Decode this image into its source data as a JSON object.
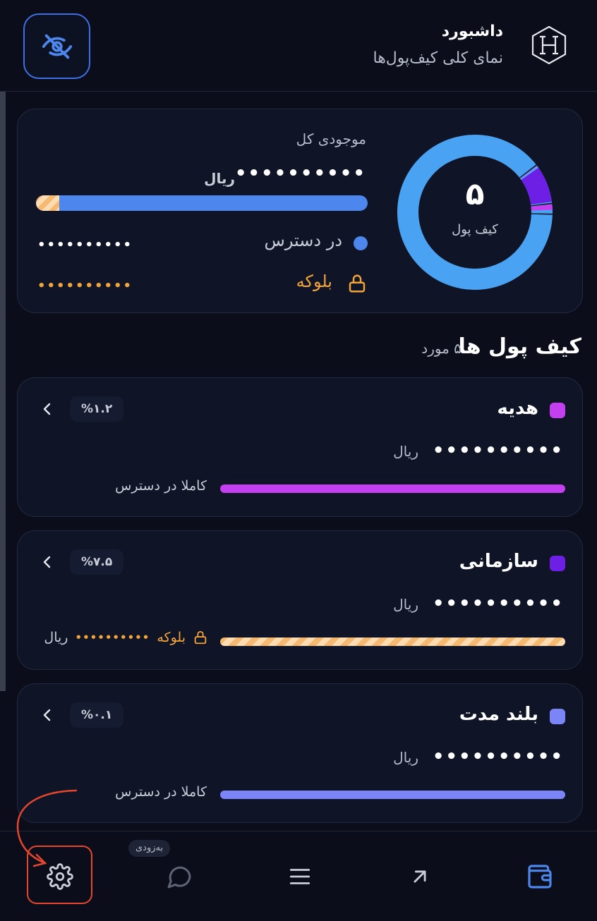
{
  "header": {
    "title": "داشبورد",
    "subtitle": "نمای کلی کیف‌پول‌ها",
    "logo_icon": "hexagon-h-logo",
    "visibility_icon": "eye-off-icon"
  },
  "summary": {
    "wallet_count": "۵",
    "wallet_count_label": "کیف پول",
    "total_label": "موجودی کل",
    "total_value": "••••••••••",
    "currency": "ریال",
    "available_label": "در دسترس",
    "available_value": "••••••••••",
    "blocked_label": "بلوکه",
    "blocked_value": "••••••••••",
    "blocked_fraction": 0.07,
    "colors": {
      "available": "#4d86ec",
      "blocked": "#f6b971"
    }
  },
  "wallets_section": {
    "title": "کیف پول ها",
    "count": "۵ مورد"
  },
  "wallets": [
    {
      "name": "هدیه",
      "color": "#c33ff0",
      "percent": "%۱.۲",
      "balance": "••••••••••",
      "currency": "ریال",
      "status": "کاملا در دسترس",
      "blocked": false
    },
    {
      "name": "سازمانی",
      "color": "#6d1fe6",
      "percent": "%۷.۵",
      "balance": "••••••••••",
      "currency": "ریال",
      "status": "بلوکه",
      "blocked_value": "••••••••••",
      "blocked_currency": "ریال",
      "blocked": true
    },
    {
      "name": "بلند مدت",
      "color": "#7c85f8",
      "percent": "%۰.۱",
      "balance": "••••••••••",
      "currency": "ریال",
      "status": "کاملا در دسترس",
      "blocked": false
    }
  ],
  "nav": {
    "items": [
      {
        "name": "settings",
        "icon": "gear-icon"
      },
      {
        "name": "chat",
        "icon": "chat-bubble-icon",
        "badge": "به‌زودی"
      },
      {
        "name": "menu",
        "icon": "menu-icon"
      },
      {
        "name": "transfer",
        "icon": "arrow-up-right-icon"
      },
      {
        "name": "wallet",
        "icon": "wallet-icon",
        "active": true
      }
    ]
  }
}
